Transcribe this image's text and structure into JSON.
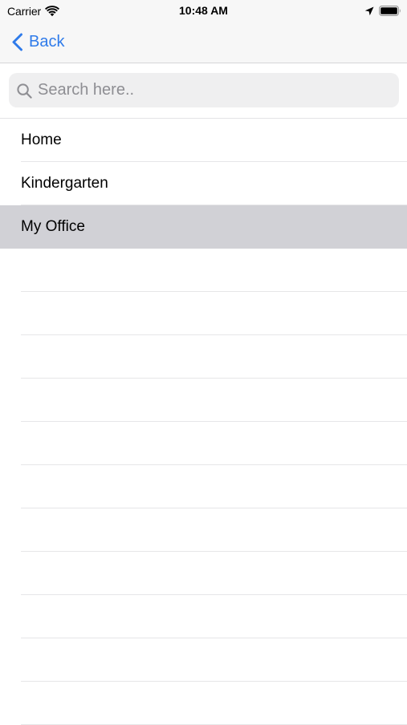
{
  "status_bar": {
    "carrier": "Carrier",
    "time": "10:48 AM",
    "icons": [
      "wifi-icon",
      "location-icon",
      "battery-icon"
    ]
  },
  "nav": {
    "back_label": "Back",
    "accent_color": "#2f7bea"
  },
  "search": {
    "placeholder": "Search here..",
    "value": ""
  },
  "list": {
    "items": [
      {
        "label": "Home",
        "selected": false
      },
      {
        "label": "Kindergarten",
        "selected": false
      },
      {
        "label": "My Office",
        "selected": true
      }
    ],
    "selected_color": "#d1d1d6"
  }
}
